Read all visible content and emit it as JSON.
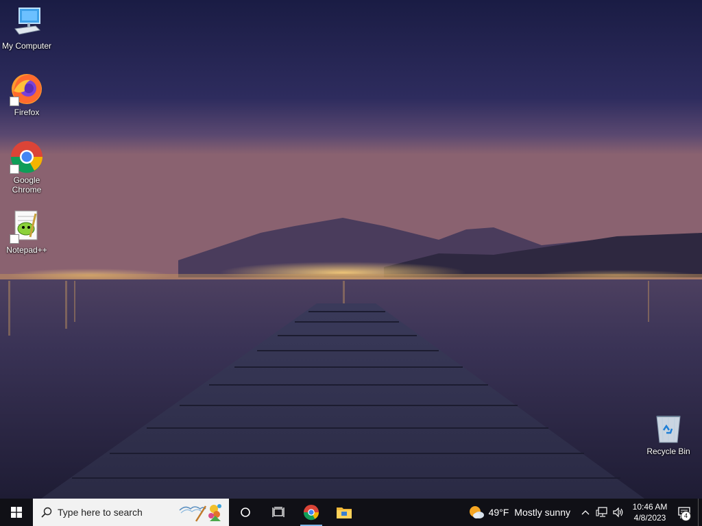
{
  "desktop": {
    "icons": [
      {
        "label": "My Computer",
        "icon": "computer-icon"
      },
      {
        "label": "Firefox",
        "icon": "firefox-icon"
      },
      {
        "label": "Google Chrome",
        "icon": "chrome-icon"
      },
      {
        "label": "Notepad++",
        "icon": "notepadpp-icon"
      },
      {
        "label": "Recycle Bin",
        "icon": "recycle-bin-icon"
      }
    ]
  },
  "taskbar": {
    "search_placeholder": "Type here to search",
    "pinned": [
      "cortana-icon",
      "task-view-icon",
      "chrome-icon",
      "file-explorer-icon"
    ],
    "weather": {
      "temp": "49°F",
      "desc": "Mostly sunny",
      "icon": "partly-sunny-icon"
    },
    "tray_icons": [
      "chevron-up-icon",
      "network-icon",
      "volume-icon"
    ],
    "clock": {
      "time": "10:46 AM",
      "date": "4/8/2023"
    },
    "notifications_count": "4"
  },
  "colors": {
    "taskbar": "#101016",
    "search_bg": "#f2f2f2",
    "active_indicator": "#7fb6e8"
  }
}
